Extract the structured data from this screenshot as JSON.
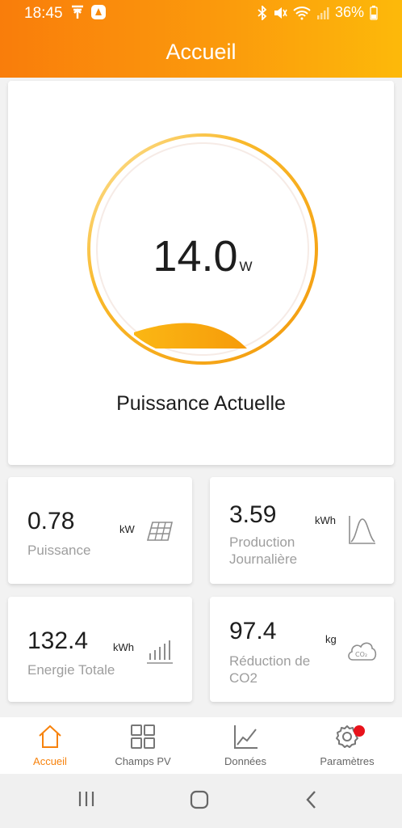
{
  "status_bar": {
    "time": "18:45",
    "battery": "36%"
  },
  "header": {
    "title": "Accueil"
  },
  "current_power": {
    "value": "14.0",
    "unit": "W",
    "label": "Puissance Actuelle",
    "fill_fraction": 0.1
  },
  "stats": [
    {
      "value": "0.78",
      "unit": "kW",
      "label": "Puissance",
      "icon": "solar-panel-icon"
    },
    {
      "value": "3.59",
      "unit": "kWh",
      "label_line1": "Production",
      "label_line2": "Journalière",
      "icon": "production-curve-icon"
    },
    {
      "value": "132.4",
      "unit": "kWh",
      "label": "Energie Totale",
      "icon": "bar-chart-icon"
    },
    {
      "value": "97.4",
      "unit": "kg",
      "label_line1": "Réduction de",
      "label_line2": "CO2",
      "icon": "co2-cloud-icon"
    }
  ],
  "nav": [
    {
      "label": "Accueil",
      "icon": "home-icon",
      "active": true
    },
    {
      "label": "Champs PV",
      "icon": "grid-icon",
      "active": false
    },
    {
      "label": "Données",
      "icon": "line-chart-icon",
      "active": false
    },
    {
      "label": "Paramètres",
      "icon": "gear-icon",
      "active": false,
      "badge": true
    }
  ],
  "colors": {
    "accent": "#f7820c",
    "header_start": "#f97d0b",
    "header_end": "#fdb90a",
    "badge": "#e8131b"
  }
}
